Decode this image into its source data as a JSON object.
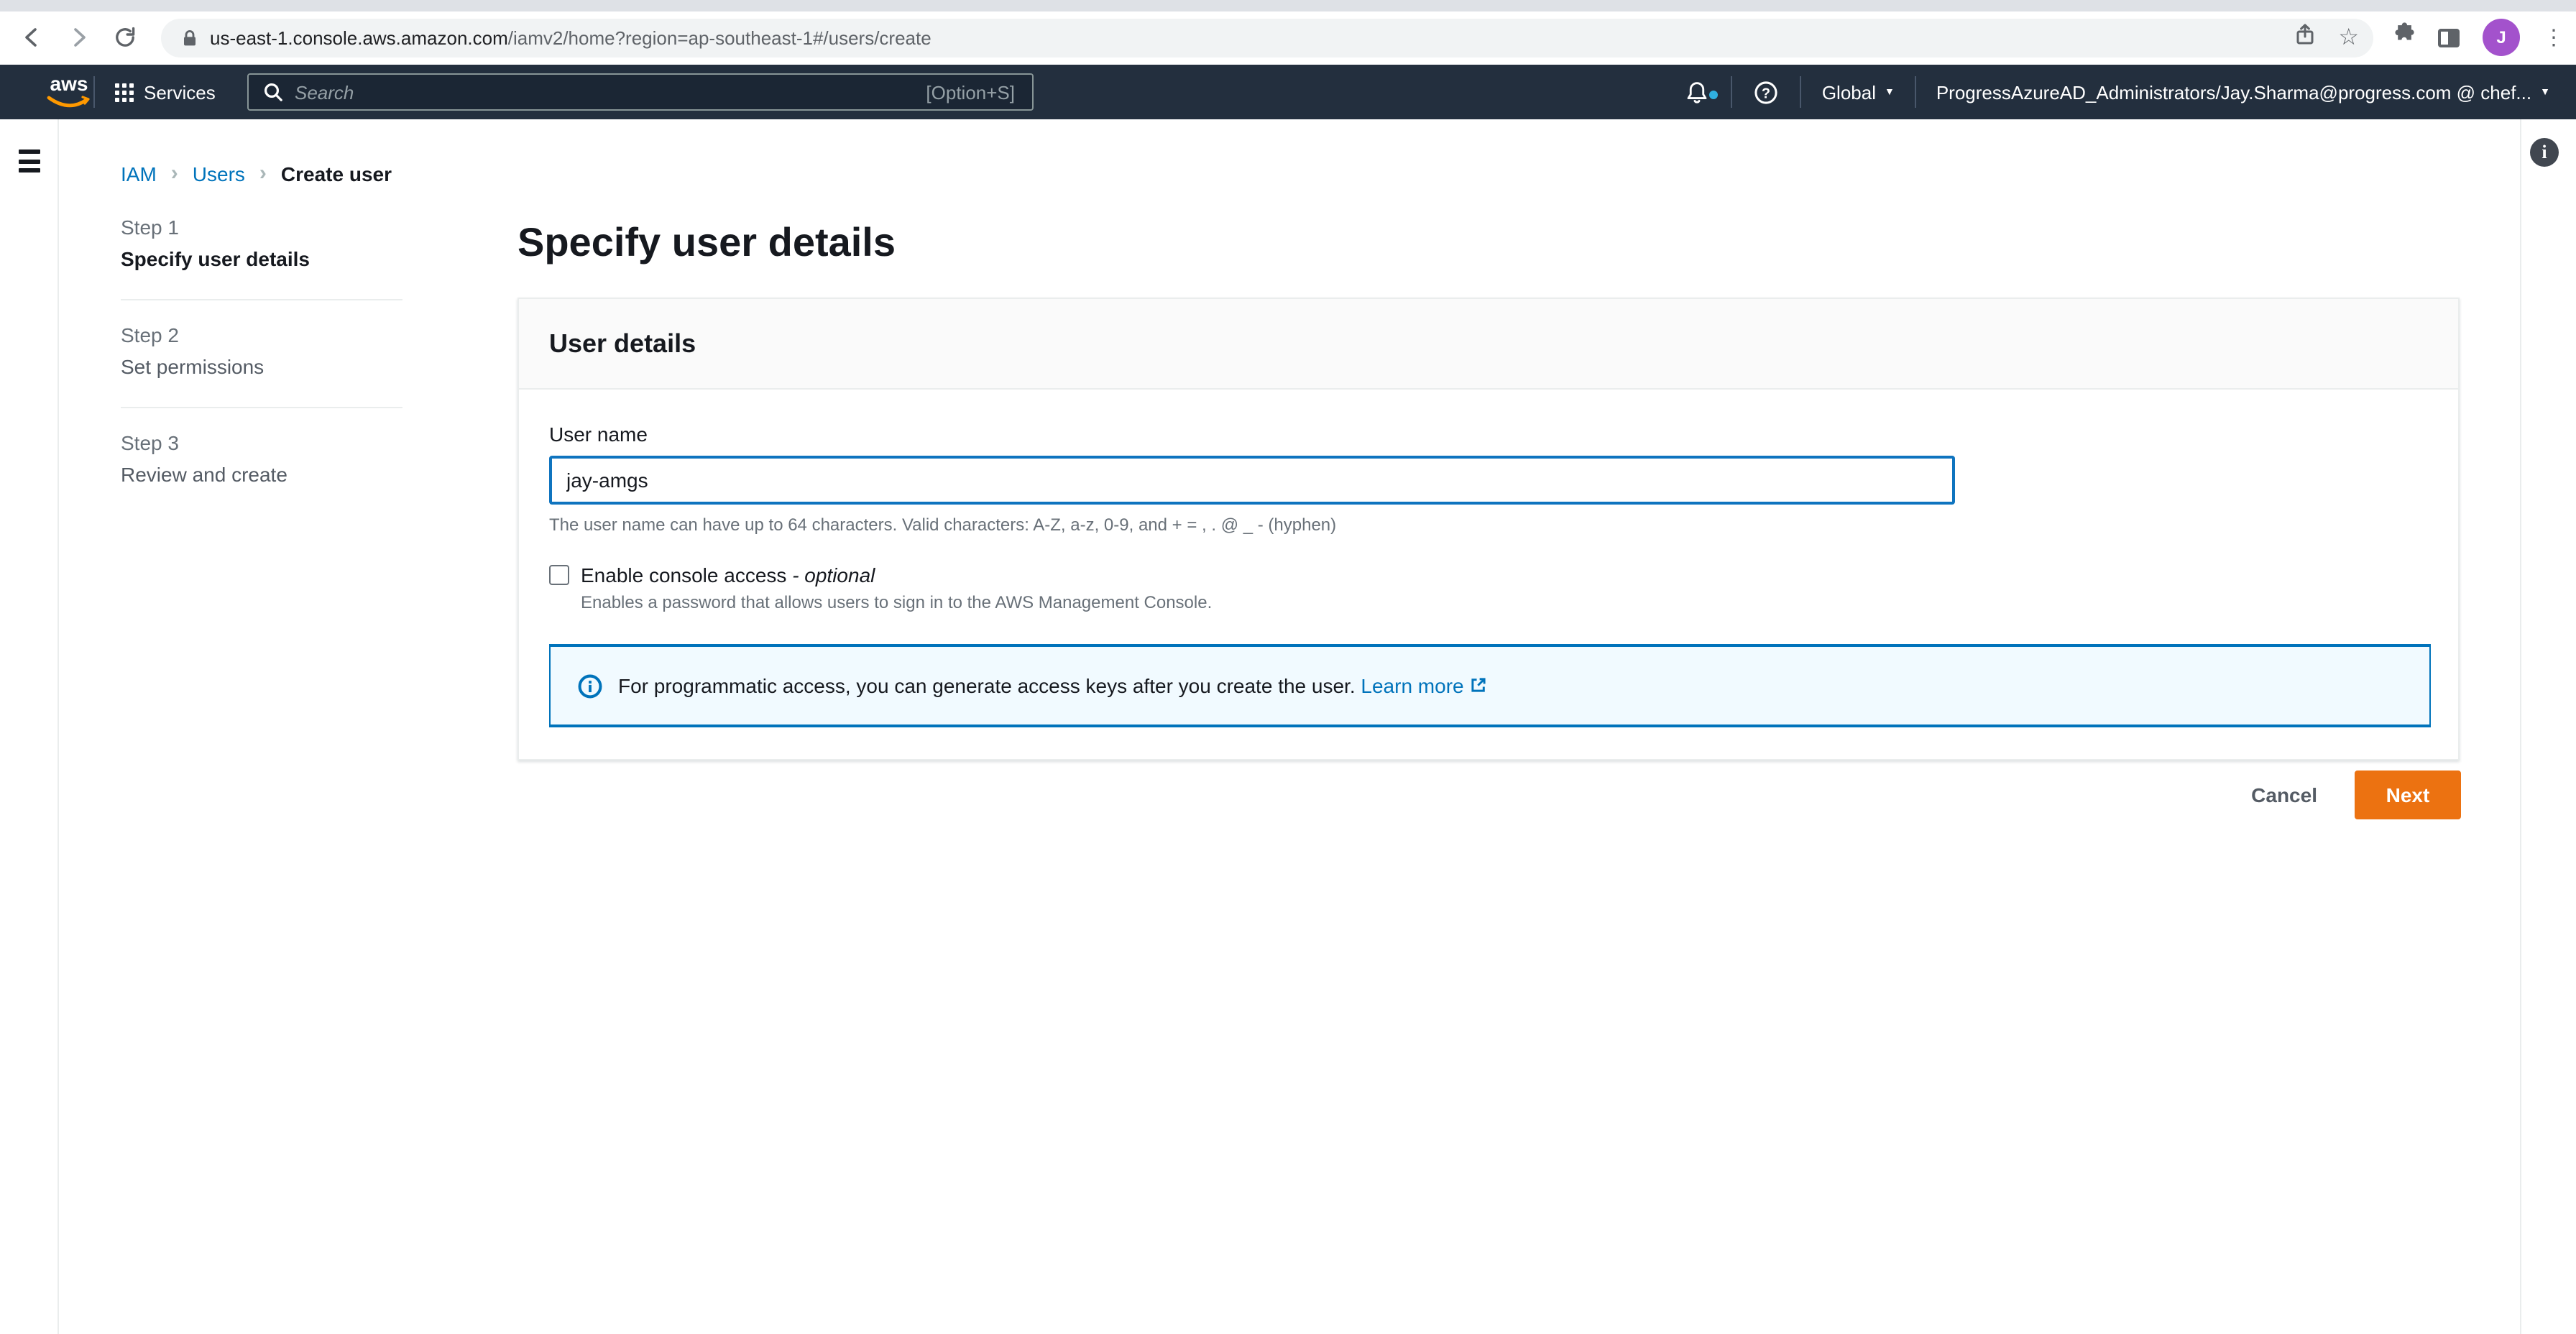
{
  "browser": {
    "url_domain": "us-east-1.console.aws.amazon.com",
    "url_path": "/iamv2/home?region=ap-southeast-1#/users/create",
    "avatar_initial": "J",
    "star_glyph": "☆",
    "menu_glyph": "⋮"
  },
  "aws_nav": {
    "logo_text": "aws",
    "services_label": "Services",
    "search_placeholder": "Search",
    "search_shortcut": "[Option+S]",
    "region_label": "Global",
    "caret_glyph": "▼",
    "account_label": "ProgressAzureAD_Administrators/Jay.Sharma@progress.com @ chef...",
    "navbar_bg": "#232f3e",
    "logo_accent": "#ff9900"
  },
  "breadcrumb": {
    "separator": "›",
    "items": [
      {
        "label": "IAM"
      },
      {
        "label": "Users"
      },
      {
        "label": "Create user"
      }
    ]
  },
  "steps": [
    {
      "step": "Step 1",
      "title": "Specify user details"
    },
    {
      "step": "Step 2",
      "title": "Set permissions"
    },
    {
      "step": "Step 3",
      "title": "Review and create"
    }
  ],
  "main": {
    "heading": "Specify user details",
    "card": {
      "title": "User details",
      "username_label": "User name",
      "username_value": "jay-amgs",
      "username_help": "The user name can have up to 64 characters. Valid characters: A-Z, a-z, 0-9, and + = , . @ _ - (hyphen)",
      "console_access_label": "Enable console access ",
      "console_access_optional": "- optional",
      "console_access_help": "Enables a password that allows users to sign in to the AWS Management Console.",
      "info_alert_text": "For programmatic access, you can generate access keys after you create the user.",
      "info_alert_link": "Learn more"
    },
    "actions": {
      "cancel_label": "Cancel",
      "next_label": "Next"
    }
  },
  "right_panel": {
    "info_glyph": "i"
  },
  "colors": {
    "accent_blue": "#0073bb",
    "focus_border": "#0f74bf",
    "button_orange": "#ec7211",
    "alert_bg": "#f1faff"
  }
}
